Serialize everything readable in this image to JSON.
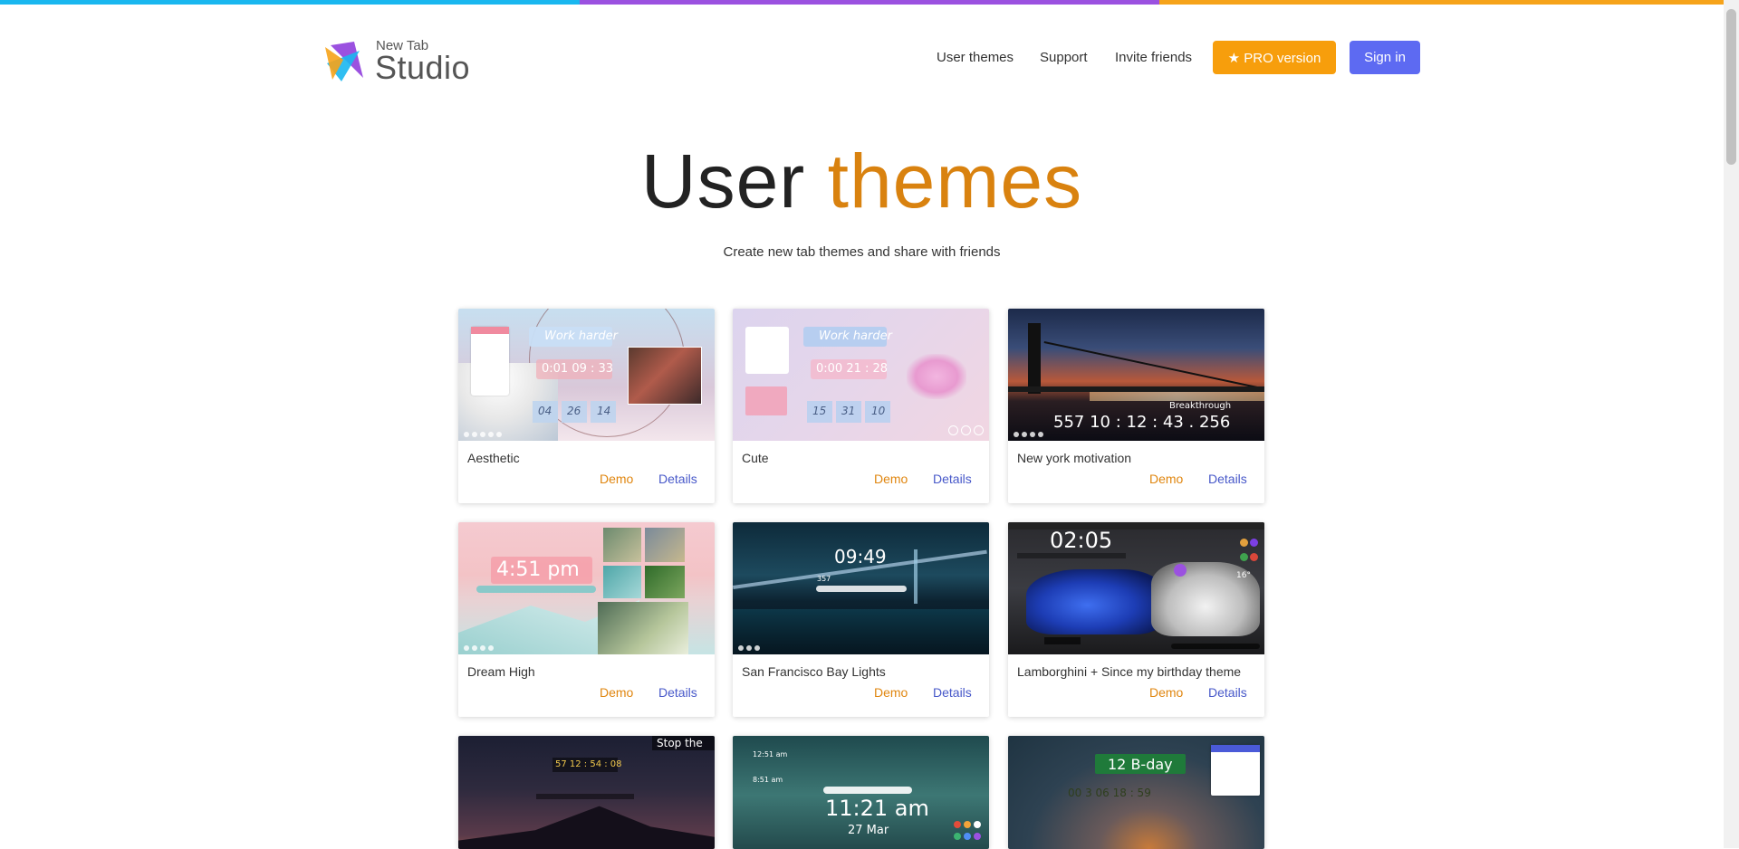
{
  "colors": {
    "top_stripe": [
      "#19b7ef",
      "#9b51e0",
      "#f6a31a"
    ],
    "accent": "#d9820f",
    "pro_button": "#f79e0c",
    "signin_button": "#5d6af2",
    "demo_link": "#e0860f",
    "details_link": "#4758c9"
  },
  "logo": {
    "small": "New Tab",
    "big": "Studio"
  },
  "nav": {
    "user_themes": "User themes",
    "support": "Support",
    "invite_friends": "Invite friends",
    "pro": "★ PRO version",
    "sign_in": "Sign in"
  },
  "hero": {
    "title_plain": "User",
    "title_accent": "themes",
    "subtitle": "Create new tab themes and share with friends"
  },
  "card_actions": {
    "demo": "Demo",
    "details": "Details"
  },
  "themes": [
    {
      "title": "Aesthetic",
      "preview_text": [
        "Work harder",
        "0:01 09 : 33",
        "04",
        "26",
        "14"
      ]
    },
    {
      "title": "Cute",
      "preview_text": [
        "Work harder",
        "0:00 21 : 28",
        "15",
        "31",
        "10"
      ]
    },
    {
      "title": "New york motivation",
      "preview_text": [
        "557 10 : 12 : 43 . 256",
        "Breakthrough"
      ]
    },
    {
      "title": "Dream High",
      "preview_text": [
        "4:51 pm"
      ]
    },
    {
      "title": "San Francisco Bay Lights",
      "preview_text": [
        "09:49",
        "357"
      ]
    },
    {
      "title": "Lamborghini + Since my birthday theme",
      "preview_text": [
        "02:05",
        "16°"
      ]
    },
    {
      "preview_text": [
        "Stop the",
        "57 12 : 54 : 08"
      ]
    },
    {
      "preview_text": [
        "12:51 am",
        "8:51 am",
        "11:21 am",
        "27 Mar"
      ]
    },
    {
      "preview_text": [
        "12 B-day",
        "00 3 06 18 : 59"
      ]
    }
  ]
}
